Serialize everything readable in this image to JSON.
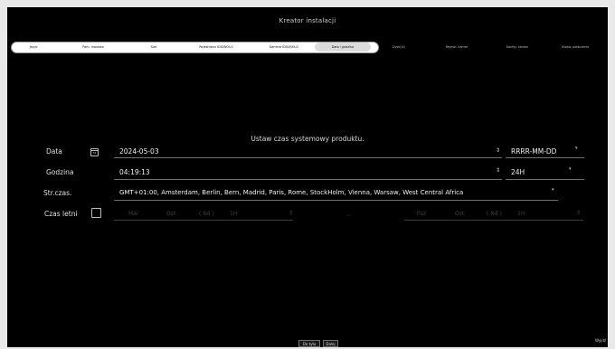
{
  "window": {
    "title": "Kreator instalacji"
  },
  "steps": [
    {
      "label": "Język",
      "state": "done"
    },
    {
      "label": "Pam. masowa",
      "state": "done"
    },
    {
      "label": "Sieć",
      "state": "done"
    },
    {
      "label": "Rejestrator IDIS/NOLO",
      "state": "done"
    },
    {
      "label": "Kamera IDIS/NOLO",
      "state": "done"
    },
    {
      "label": "Data i godzina",
      "state": "active"
    },
    {
      "label": "Dysk(ki)",
      "state": "future"
    },
    {
      "label": "Rejestr. kamer",
      "state": "future"
    },
    {
      "label": "Konfig. kanału",
      "state": "future"
    },
    {
      "label": "Ustaw. połączenie",
      "state": "future"
    }
  ],
  "main": {
    "instruction": "Ustaw czas systemowy produktu.",
    "date": {
      "label": "Data",
      "calendar_icon_text": "31",
      "value": "2024-05-03",
      "format": "RRRR-MM-DD"
    },
    "time": {
      "label": "Godzina",
      "value": "04:19:13",
      "format": "24H"
    },
    "timezone": {
      "label": "Str.czas.",
      "value": "GMT+01:00, Amsterdam, Berlin, Bern, Madrid, Paris, Rome, StockHolm, Vienna, Warsaw, West Central Africa"
    },
    "dst": {
      "label": "Czas letni",
      "start": {
        "month": "Mar",
        "week": "Ost",
        "day": "( Nd )",
        "hour": "1H"
      },
      "separator": "~",
      "end": {
        "month": "Paź",
        "week": "Ost",
        "day": "( Nd )",
        "hour": "1H"
      }
    }
  },
  "footer": {
    "back_label": "Do tyłu",
    "skip_label": "Dalej",
    "next_label": "Wyjdź"
  },
  "icons": {
    "spinner": "updown-arrows-icon",
    "dropdown": "chevron-down-icon",
    "calendar": "calendar-icon"
  }
}
